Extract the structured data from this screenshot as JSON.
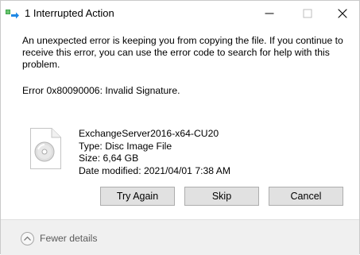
{
  "window": {
    "title": "1 Interrupted Action",
    "controls": {
      "minimize_icon": "minimize-icon",
      "maximize_icon": "maximize-icon",
      "close_icon": "close-icon"
    }
  },
  "message": {
    "body": "An unexpected error is keeping you from copying the file. If you continue to receive this error, you can use the error code to search for help with this problem.",
    "error": "Error 0x80090006: Invalid Signature."
  },
  "file": {
    "icon": "disc-image-file-icon",
    "name": "ExchangeServer2016-x64-CU20",
    "type": "Type: Disc Image File",
    "size": "Size: 6,64 GB",
    "modified": "Date modified: 2021/04/01 7:38 AM"
  },
  "buttons": {
    "try_again": "Try Again",
    "skip": "Skip",
    "cancel": "Cancel"
  },
  "footer": {
    "toggle_icon": "chevron-up-icon",
    "toggle_label": "Fewer details"
  },
  "colors": {
    "button_bg": "#e1e1e1",
    "button_border": "#adadad",
    "footer_bg": "#f0f0f0",
    "footer_text": "#5b5b5b",
    "icon_green": "#3ba54a",
    "icon_blue": "#1e88e5"
  }
}
